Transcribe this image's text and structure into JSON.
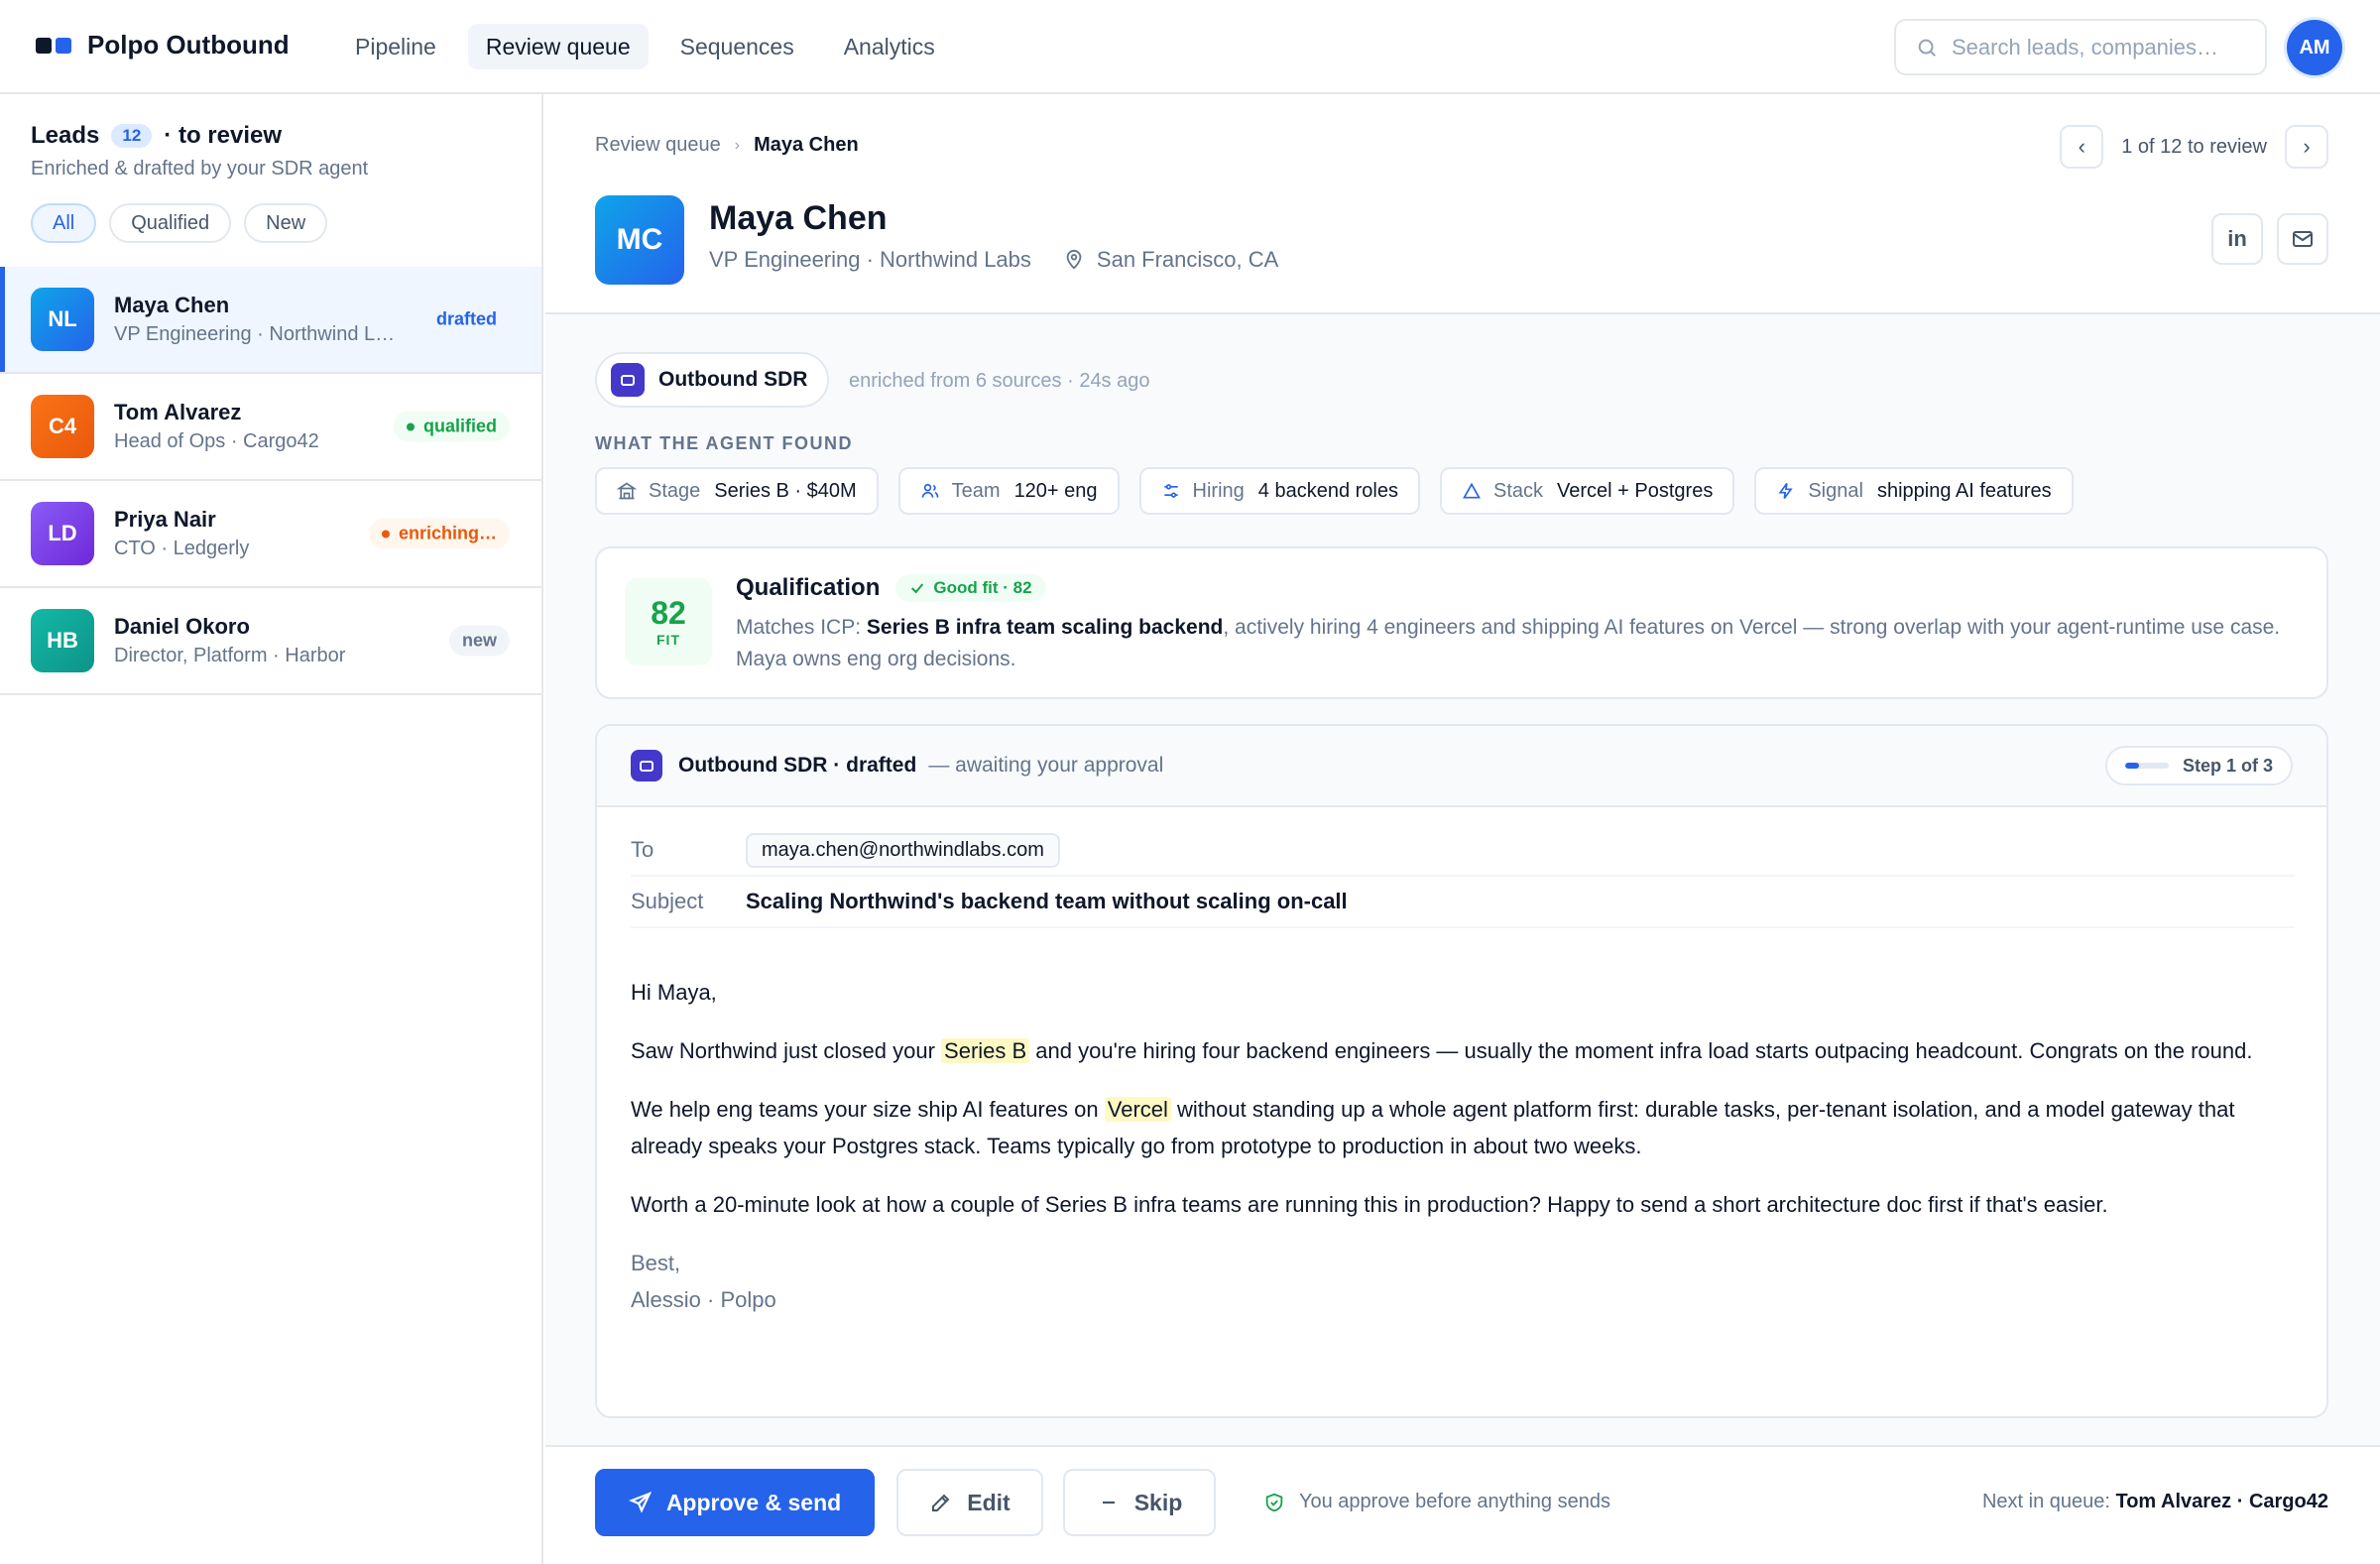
{
  "app": {
    "name": "Polpo Outbound",
    "colors": {
      "accent": "#2563eb",
      "success": "#16a34a",
      "warning": "#ea580c",
      "agent": "#4338ca"
    }
  },
  "nav": {
    "items": [
      {
        "label": "Pipeline",
        "active": false
      },
      {
        "label": "Review queue",
        "active": true
      },
      {
        "label": "Sequences",
        "active": false
      },
      {
        "label": "Analytics",
        "active": false
      }
    ]
  },
  "search": {
    "placeholder": "Search leads, companies…",
    "value": "",
    "icon": "search-icon"
  },
  "user": {
    "initials": "AM"
  },
  "sidebar": {
    "title": "Leads",
    "count": "12",
    "title_suffix": "· to review",
    "subtitle": "Enriched & drafted by your SDR agent",
    "filters": [
      {
        "label": "All",
        "active": true
      },
      {
        "label": "Qualified",
        "active": false
      },
      {
        "label": "New",
        "active": false
      }
    ],
    "leads": [
      {
        "initials": "NL",
        "name": "Maya Chen",
        "role": "VP Engineering · Northwind L…",
        "status": "drafted",
        "color": "#2563eb",
        "selected": true
      },
      {
        "initials": "C4",
        "name": "Tom Alvarez",
        "role": "Head of Ops · Cargo42",
        "status": "qualified",
        "color": "#ea580c",
        "selected": false
      },
      {
        "initials": "LD",
        "name": "Priya Nair",
        "role": "CTO · Ledgerly",
        "status": "enriching…",
        "color": "#7c3aed",
        "selected": false
      },
      {
        "initials": "HB",
        "name": "Daniel Okoro",
        "role": "Director, Platform · Harbor",
        "status": "new",
        "color": "#0d9488",
        "selected": false
      }
    ]
  },
  "breadcrumb": {
    "root": "Review queue",
    "current": "Maya Chen"
  },
  "pager": {
    "prev": "‹",
    "text": "1 of 12 to review",
    "next": "›"
  },
  "profile": {
    "initials": "MC",
    "name": "Maya Chen",
    "title": "VP Engineering · Northwind Labs",
    "location": "San Francisco, CA",
    "linkedin_label": "in"
  },
  "agent": {
    "name": "Outbound SDR",
    "meta": "enriched from 6 sources · 24s ago"
  },
  "findings": {
    "label": "WHAT THE AGENT FOUND",
    "facts": [
      {
        "key": "Stage",
        "value": "Series B · $40M",
        "icon": "bank-icon"
      },
      {
        "key": "Team",
        "value": "120+ eng",
        "icon": "users-icon"
      },
      {
        "key": "Hiring",
        "value": "4 backend roles",
        "icon": "sliders-icon"
      },
      {
        "key": "Stack",
        "value": "Vercel + Postgres",
        "icon": "triangle-icon"
      },
      {
        "key": "Signal",
        "value": "shipping AI features",
        "icon": "bolt-icon"
      }
    ]
  },
  "qualification": {
    "score": "82",
    "score_label": "FIT",
    "title": "Qualification",
    "badge": "Good fit · 82",
    "text_prefix": "Matches ICP: ",
    "text_bold": "Series B infra team scaling backend",
    "text_rest": ", actively hiring 4 engineers and shipping AI features on Vercel — strong overlap with your agent-runtime use case. Maya owns eng org decisions."
  },
  "draft": {
    "title": "Outbound SDR · drafted",
    "status": "— awaiting your approval",
    "step": "Step 1 of 3",
    "step_progress": 0.33,
    "to_label": "To",
    "to": "maya.chen@northwindlabs.com",
    "subject_label": "Subject",
    "subject": "Scaling Northwind's backend team without scaling on-call",
    "greeting": "Hi Maya,",
    "p1_a": "Saw Northwind just closed your ",
    "p1_hl": "Series B",
    "p1_b": " and you're hiring four backend engineers — usually the moment infra load starts outpacing headcount. Congrats on the round.",
    "p2_a": "We help eng teams your size ship AI features on ",
    "p2_hl": "Vercel",
    "p2_b": " without standing up a whole agent platform first: durable tasks, per-tenant isolation, and a model gateway that already speaks your Postgres stack. Teams typically go from prototype to production in about two weeks.",
    "p3": "Worth a 20-minute look at how a couple of Series B infra teams are running this in production? Happy to send a short architecture doc first if that's easier.",
    "signoff": "Best,",
    "signature": "Alessio · Polpo"
  },
  "actions": {
    "approve": "Approve & send",
    "edit": "Edit",
    "skip": "Skip",
    "safety": "You approve before anything sends",
    "next_label": "Next in queue: ",
    "next_value": "Tom Alvarez · Cargo42"
  }
}
